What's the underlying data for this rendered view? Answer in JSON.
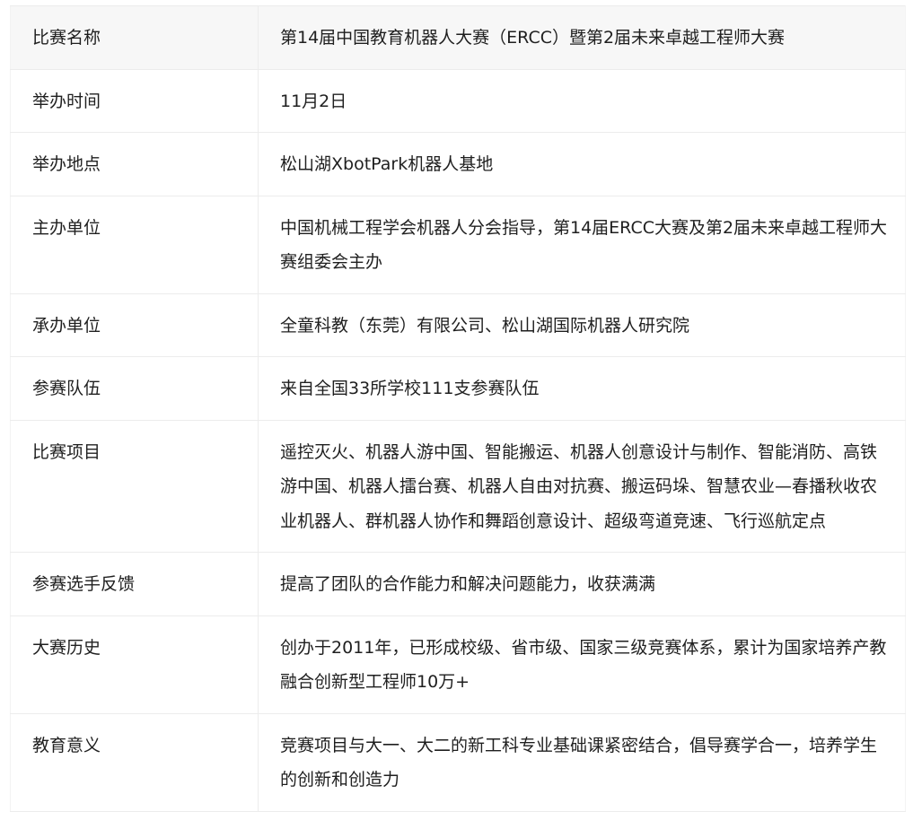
{
  "table": {
    "rows": [
      {
        "label": "比赛名称",
        "value": "第14届中国教育机器人大赛（ERCC）暨第2届未来卓越工程师大赛"
      },
      {
        "label": "举办时间",
        "value": "11月2日"
      },
      {
        "label": "举办地点",
        "value": "松山湖XbotPark机器人基地"
      },
      {
        "label": "主办单位",
        "value": "中国机械工程学会机器人分会指导，第14届ERCC大赛及第2届未来卓越工程师大赛组委会主办"
      },
      {
        "label": "承办单位",
        "value": "全童科教（东莞）有限公司、松山湖国际机器人研究院"
      },
      {
        "label": "参赛队伍",
        "value": "来自全国33所学校111支参赛队伍"
      },
      {
        "label": "比赛项目",
        "value": "遥控灭火、机器人游中国、智能搬运、机器人创意设计与制作、智能消防、高铁游中国、机器人擂台赛、机器人自由对抗赛、搬运码垛、智慧农业—春播秋收农业机器人、群机器人协作和舞蹈创意设计、超级弯道竞速、飞行巡航定点"
      },
      {
        "label": "参赛选手反馈",
        "value": "提高了团队的合作能力和解决问题能力，收获满满"
      },
      {
        "label": "大赛历史",
        "value": "创办于2011年，已形成校级、省市级、国家三级竞赛体系，累计为国家培养产教融合创新型工程师10万+"
      },
      {
        "label": "教育意义",
        "value": "竞赛项目与大一、大二的新工科专业基础课紧密结合，倡导赛学合一，培养学生的创新和创造力"
      }
    ]
  }
}
